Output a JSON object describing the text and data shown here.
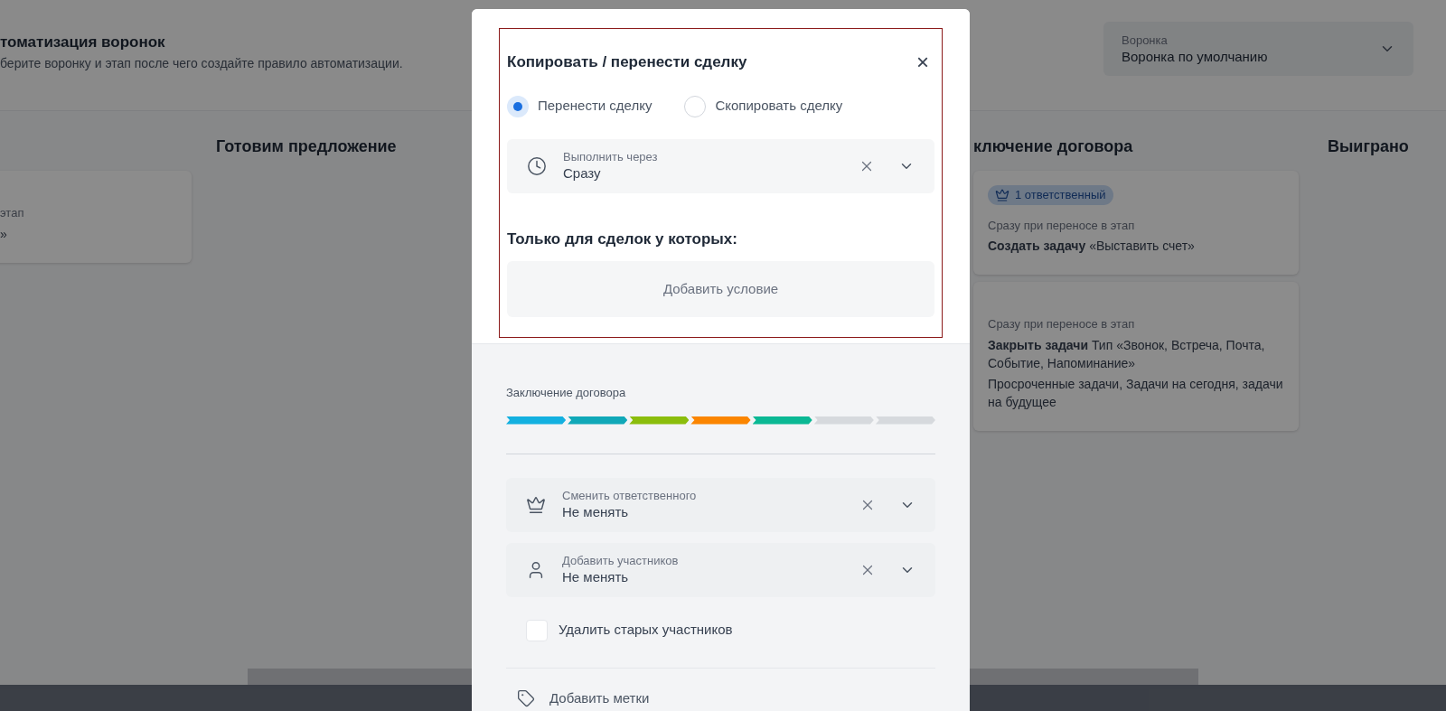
{
  "page": {
    "title": "томатизация воронок",
    "subtitle": "берите воронку и этап после чего создайте правило автоматизации.",
    "funnel_select": {
      "label": "Воронка",
      "value": "Воронка по умолчанию"
    }
  },
  "columns": [
    {
      "cards": [
        {
          "lines": [
            "этап",
            "»"
          ]
        }
      ]
    },
    {
      "title": "Готовим предложение"
    },
    {},
    {
      "title": "ключение договора",
      "cards": [
        {
          "badge": "1 ответственный",
          "lines": [
            "Сразу при переносе в этап",
            "**Создать задачу** «Выставить счет»"
          ]
        },
        {
          "lines": [
            "Сразу при переносе в этап",
            "**Закрыть задачи** Тип «Звонок, Встреча, Почта, Событие, Напоминание»",
            "Просроченные задачи, Задачи на сегодня, задачи на будущее"
          ]
        }
      ]
    },
    {
      "title": "Выиграно"
    }
  ],
  "modal": {
    "title": "Копировать / перенести сделку",
    "close": "×",
    "options": [
      {
        "label": "Перенести сделку",
        "selected": true
      },
      {
        "label": "Скопировать сделку",
        "selected": false
      }
    ],
    "delay": {
      "label": "Выполнить через",
      "value": "Сразу"
    },
    "conditions_title": "Только для сделок у которых:",
    "add_condition": "Добавить условие",
    "stage_label": "Заключение договора",
    "stages": [
      {
        "color": "#13b0e0"
      },
      {
        "color": "#10a8b8"
      },
      {
        "color": "#8bbd0c"
      },
      {
        "color": "#fb8500"
      },
      {
        "color": "#0ab894"
      },
      {
        "color": "#d6d9dd"
      },
      {
        "color": "#d6d9dd"
      }
    ],
    "selects": [
      {
        "label": "Сменить ответственного",
        "value": "Не менять"
      },
      {
        "label": "Добавить участников",
        "value": "Не менять"
      }
    ],
    "remove_old": {
      "label": "Удалить старых участников",
      "checked": false
    },
    "tags": {
      "label": "Добавить метки"
    }
  }
}
